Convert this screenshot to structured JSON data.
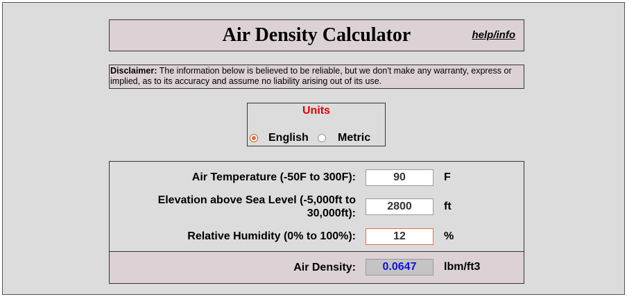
{
  "header": {
    "title": "Air Density Calculator",
    "help_link": "help/info"
  },
  "disclaimer": {
    "label": "Disclaimer:",
    "text": " The information below is believed to be reliable, but we don't make any warranty, express or implied, as to its accuracy and assume no liability arising out of its use."
  },
  "units": {
    "title": "Units",
    "options": [
      {
        "label": "English",
        "selected": true
      },
      {
        "label": "Metric",
        "selected": false
      }
    ]
  },
  "inputs": [
    {
      "label": "Air Temperature (-50F to 300F):",
      "value": "90",
      "unit": "F"
    },
    {
      "label_line1": "Elevation above Sea Level (-5,000ft to",
      "label_line2": "30,000ft):",
      "value": "2800",
      "unit": "ft"
    },
    {
      "label": "Relative Humidity (0% to 100%):",
      "value": "12",
      "unit": "%"
    }
  ],
  "result": {
    "label": "Air Density:",
    "value": "0.0647",
    "unit": "lbm/ft3"
  },
  "colors": {
    "units_title": "#e00000",
    "result_value": "#1010e0",
    "panel_bg": "#dcd2d6",
    "page_bg": "#dcdcdc"
  }
}
